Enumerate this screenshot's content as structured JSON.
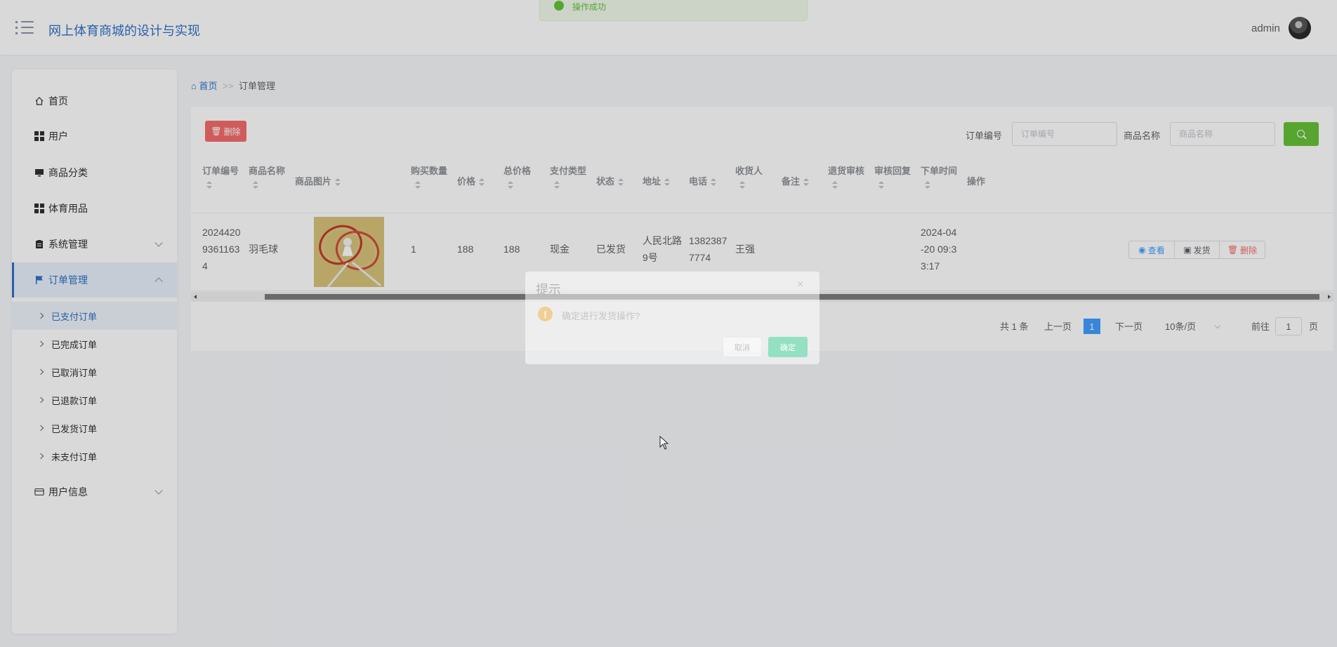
{
  "header": {
    "app_title": "网上体育商城的设计与实现",
    "user_name": "admin"
  },
  "toast": {
    "text": "操作成功"
  },
  "sidebar": {
    "items": [
      {
        "label": "首页",
        "icon": "home-icon"
      },
      {
        "label": "用户",
        "icon": "grid-icon"
      },
      {
        "label": "商品分类",
        "icon": "monitor-icon"
      },
      {
        "label": "体育用品",
        "icon": "grid-icon"
      },
      {
        "label": "系统管理",
        "icon": "clipboard-icon"
      },
      {
        "label": "订单管理",
        "icon": "flag-icon"
      },
      {
        "label": "用户信息",
        "icon": "wallet-icon"
      }
    ],
    "sub_items": [
      {
        "label": "已支付订单"
      },
      {
        "label": "已完成订单"
      },
      {
        "label": "已取消订单"
      },
      {
        "label": "已退款订单"
      },
      {
        "label": "已发货订单"
      },
      {
        "label": "未支付订单"
      }
    ]
  },
  "breadcrumb": {
    "home": "首页",
    "separator": ">>",
    "current": "订单管理"
  },
  "toolbar": {
    "delete_label": "删除",
    "order_no_label": "订单编号",
    "order_no_placeholder": "订单编号",
    "product_name_label": "商品名称",
    "product_name_placeholder": "商品名称"
  },
  "table": {
    "columns": [
      "订单编号",
      "商品名称",
      "商品图片",
      "购买数量",
      "价格",
      "总价格",
      "支付类型",
      "状态",
      "地址",
      "电话",
      "收货人",
      "备注",
      "退货审核",
      "审核回复",
      "下单时间",
      "操作"
    ],
    "rows": [
      {
        "order_no_l1": "2024420",
        "order_no_l2": "9361163",
        "order_no_l3": "4",
        "product_name": "羽毛球",
        "quantity": "1",
        "price": "188",
        "total": "188",
        "pay_type": "现金",
        "status": "已发货",
        "address_l1": "人民北路",
        "address_l2": "9号",
        "phone_l1": "1382387",
        "phone_l2": "7774",
        "receiver": "王强",
        "remark": "",
        "return_review": "",
        "review_reply": "",
        "time_l1": "2024-04",
        "time_l2": "-20 09:3",
        "time_l3": "3:17",
        "view_label": "查看",
        "ship_label": "发货",
        "delete_label": "删除"
      }
    ]
  },
  "pagination": {
    "total": "共 1 条",
    "prev": "上一页",
    "current_page": "1",
    "next": "下一页",
    "page_size": "10条/页",
    "goto_prefix": "前往",
    "goto_value": "1",
    "goto_suffix": "页"
  },
  "dialog": {
    "title": "提示",
    "close": "×",
    "message": "确定进行发货操作?",
    "cancel": "取消",
    "confirm": "确定"
  },
  "colors": {
    "accent": "#2f73c6",
    "danger": "#f56c6c",
    "success": "#67c23a",
    "primary": "#409eff"
  }
}
